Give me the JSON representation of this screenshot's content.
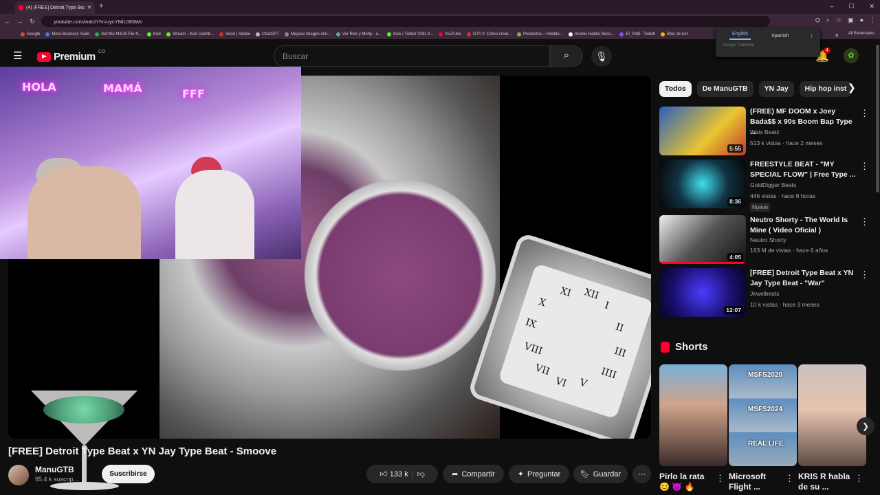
{
  "browser": {
    "tab_title": "(4) [FREE] Detroit Type Beat",
    "url": "youtube.com/watch?v=uycYMiL083Ws",
    "bookmarks": [
      "Google",
      "Meta Business Suite",
      "Get the M3U8 File fr...",
      "Kick",
      "Stream - Kick Dashb...",
      "Inicio | Adobe",
      "ChatGPT",
      "Mejorar imagen onli...",
      "Ver Rick y Morty - o...",
      "Kick / Twitch VOD d...",
      "YouTube",
      "GTA V: Cómo crear...",
      "Productos – Hobbie...",
      "Atomic Habits Reso...",
      "El_Petti - Twitch",
      "Bloc de not"
    ],
    "all_bookmarks": "All Bookmarks"
  },
  "translate": {
    "lang1": "English",
    "lang2": "Spanish",
    "footer": "Google Translate"
  },
  "youtube": {
    "logo_text": "Premium",
    "logo_country": "CO",
    "search_placeholder": "Buscar",
    "notif_count": "4"
  },
  "overlay": {
    "neon1": "HOLA",
    "neon2": "MAMÁ",
    "neon3": "FFF",
    "watch_numerals": [
      "XII",
      "I",
      "II",
      "III",
      "IIII",
      "V",
      "VI",
      "VII",
      "VIII",
      "IX",
      "X",
      "XI"
    ]
  },
  "video": {
    "title": "[FREE] Detroit Type Beat x YN Jay Type Beat - Smoove",
    "channel": "ManuGTB",
    "subscribers": "95.4 k suscrip...",
    "subscribe": "Suscribirse",
    "likes": "133 k",
    "share": "Compartir",
    "ask": "Preguntar",
    "save": "Guardar"
  },
  "chips": [
    "Todos",
    "De ManuGTB",
    "YN Jay",
    "Hip hop inst"
  ],
  "recommended": [
    {
      "title": "(FREE) MF DOOM x Joey Bada$$ x 90s Boom Bap Type ...",
      "channel": "Wais Beatz",
      "meta": "513 k vistas · hace 2 meses",
      "duration": "5:55",
      "badge": ""
    },
    {
      "title": "FREESTYLE BEAT - \"MY SPECIAL FLOW\" | Free Type ...",
      "channel": "GoldDigger Beats",
      "meta": "446 vistas · hace 8 horas",
      "duration": "8:36",
      "badge": "Nuevo"
    },
    {
      "title": "Neutro Shorty - The World Is Mine ( Video Oficial )",
      "channel": "Neutro Shorty",
      "meta": "183 M de vistas · hace 6 años",
      "duration": "4:05",
      "badge": ""
    },
    {
      "title": "[FREE] Detroit Type Beat x YN Jay Type Beat - \"War\"",
      "channel": "Jewelbeats",
      "meta": "10 k vistas · hace 3 meses",
      "duration": "12:07",
      "badge": ""
    }
  ],
  "shorts_header": "Shorts",
  "shorts": [
    {
      "title": "Pirlo la rata",
      "line2": "😊 😈 🔥"
    },
    {
      "title": "Microsoft",
      "line2": "Flight ..."
    },
    {
      "title": "KRIS R habla",
      "line2": "de su ..."
    }
  ],
  "shorts_overlay": [
    "MSFS2020",
    "MSFS2024",
    "REAL LIFE"
  ],
  "colors": {
    "accent": "#ff0033",
    "bg": "#0f0f0f",
    "chip": "#272727"
  }
}
